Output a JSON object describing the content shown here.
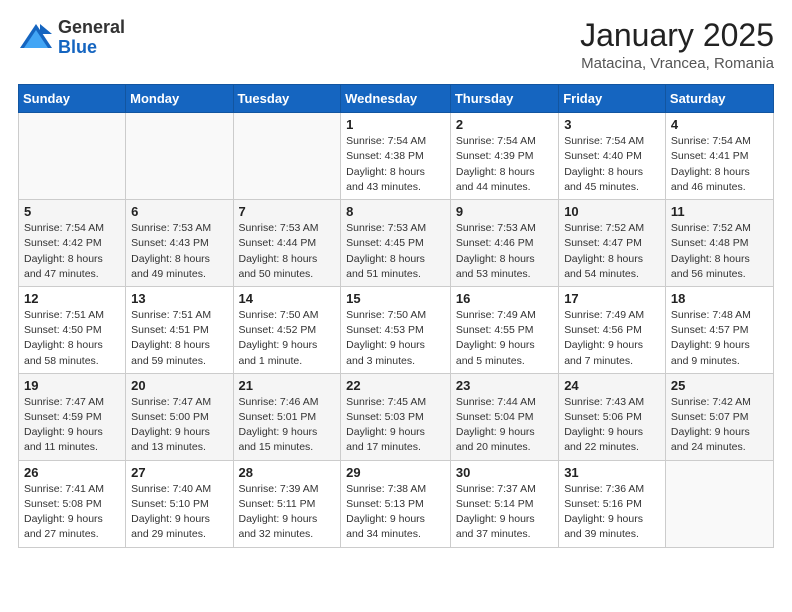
{
  "header": {
    "logo_general": "General",
    "logo_blue": "Blue",
    "month_title": "January 2025",
    "location": "Matacina, Vrancea, Romania"
  },
  "weekdays": [
    "Sunday",
    "Monday",
    "Tuesday",
    "Wednesday",
    "Thursday",
    "Friday",
    "Saturday"
  ],
  "weeks": [
    [
      {
        "day": "",
        "info": ""
      },
      {
        "day": "",
        "info": ""
      },
      {
        "day": "",
        "info": ""
      },
      {
        "day": "1",
        "info": "Sunrise: 7:54 AM\nSunset: 4:38 PM\nDaylight: 8 hours\nand 43 minutes."
      },
      {
        "day": "2",
        "info": "Sunrise: 7:54 AM\nSunset: 4:39 PM\nDaylight: 8 hours\nand 44 minutes."
      },
      {
        "day": "3",
        "info": "Sunrise: 7:54 AM\nSunset: 4:40 PM\nDaylight: 8 hours\nand 45 minutes."
      },
      {
        "day": "4",
        "info": "Sunrise: 7:54 AM\nSunset: 4:41 PM\nDaylight: 8 hours\nand 46 minutes."
      }
    ],
    [
      {
        "day": "5",
        "info": "Sunrise: 7:54 AM\nSunset: 4:42 PM\nDaylight: 8 hours\nand 47 minutes."
      },
      {
        "day": "6",
        "info": "Sunrise: 7:53 AM\nSunset: 4:43 PM\nDaylight: 8 hours\nand 49 minutes."
      },
      {
        "day": "7",
        "info": "Sunrise: 7:53 AM\nSunset: 4:44 PM\nDaylight: 8 hours\nand 50 minutes."
      },
      {
        "day": "8",
        "info": "Sunrise: 7:53 AM\nSunset: 4:45 PM\nDaylight: 8 hours\nand 51 minutes."
      },
      {
        "day": "9",
        "info": "Sunrise: 7:53 AM\nSunset: 4:46 PM\nDaylight: 8 hours\nand 53 minutes."
      },
      {
        "day": "10",
        "info": "Sunrise: 7:52 AM\nSunset: 4:47 PM\nDaylight: 8 hours\nand 54 minutes."
      },
      {
        "day": "11",
        "info": "Sunrise: 7:52 AM\nSunset: 4:48 PM\nDaylight: 8 hours\nand 56 minutes."
      }
    ],
    [
      {
        "day": "12",
        "info": "Sunrise: 7:51 AM\nSunset: 4:50 PM\nDaylight: 8 hours\nand 58 minutes."
      },
      {
        "day": "13",
        "info": "Sunrise: 7:51 AM\nSunset: 4:51 PM\nDaylight: 8 hours\nand 59 minutes."
      },
      {
        "day": "14",
        "info": "Sunrise: 7:50 AM\nSunset: 4:52 PM\nDaylight: 9 hours\nand 1 minute."
      },
      {
        "day": "15",
        "info": "Sunrise: 7:50 AM\nSunset: 4:53 PM\nDaylight: 9 hours\nand 3 minutes."
      },
      {
        "day": "16",
        "info": "Sunrise: 7:49 AM\nSunset: 4:55 PM\nDaylight: 9 hours\nand 5 minutes."
      },
      {
        "day": "17",
        "info": "Sunrise: 7:49 AM\nSunset: 4:56 PM\nDaylight: 9 hours\nand 7 minutes."
      },
      {
        "day": "18",
        "info": "Sunrise: 7:48 AM\nSunset: 4:57 PM\nDaylight: 9 hours\nand 9 minutes."
      }
    ],
    [
      {
        "day": "19",
        "info": "Sunrise: 7:47 AM\nSunset: 4:59 PM\nDaylight: 9 hours\nand 11 minutes."
      },
      {
        "day": "20",
        "info": "Sunrise: 7:47 AM\nSunset: 5:00 PM\nDaylight: 9 hours\nand 13 minutes."
      },
      {
        "day": "21",
        "info": "Sunrise: 7:46 AM\nSunset: 5:01 PM\nDaylight: 9 hours\nand 15 minutes."
      },
      {
        "day": "22",
        "info": "Sunrise: 7:45 AM\nSunset: 5:03 PM\nDaylight: 9 hours\nand 17 minutes."
      },
      {
        "day": "23",
        "info": "Sunrise: 7:44 AM\nSunset: 5:04 PM\nDaylight: 9 hours\nand 20 minutes."
      },
      {
        "day": "24",
        "info": "Sunrise: 7:43 AM\nSunset: 5:06 PM\nDaylight: 9 hours\nand 22 minutes."
      },
      {
        "day": "25",
        "info": "Sunrise: 7:42 AM\nSunset: 5:07 PM\nDaylight: 9 hours\nand 24 minutes."
      }
    ],
    [
      {
        "day": "26",
        "info": "Sunrise: 7:41 AM\nSunset: 5:08 PM\nDaylight: 9 hours\nand 27 minutes."
      },
      {
        "day": "27",
        "info": "Sunrise: 7:40 AM\nSunset: 5:10 PM\nDaylight: 9 hours\nand 29 minutes."
      },
      {
        "day": "28",
        "info": "Sunrise: 7:39 AM\nSunset: 5:11 PM\nDaylight: 9 hours\nand 32 minutes."
      },
      {
        "day": "29",
        "info": "Sunrise: 7:38 AM\nSunset: 5:13 PM\nDaylight: 9 hours\nand 34 minutes."
      },
      {
        "day": "30",
        "info": "Sunrise: 7:37 AM\nSunset: 5:14 PM\nDaylight: 9 hours\nand 37 minutes."
      },
      {
        "day": "31",
        "info": "Sunrise: 7:36 AM\nSunset: 5:16 PM\nDaylight: 9 hours\nand 39 minutes."
      },
      {
        "day": "",
        "info": ""
      }
    ]
  ]
}
